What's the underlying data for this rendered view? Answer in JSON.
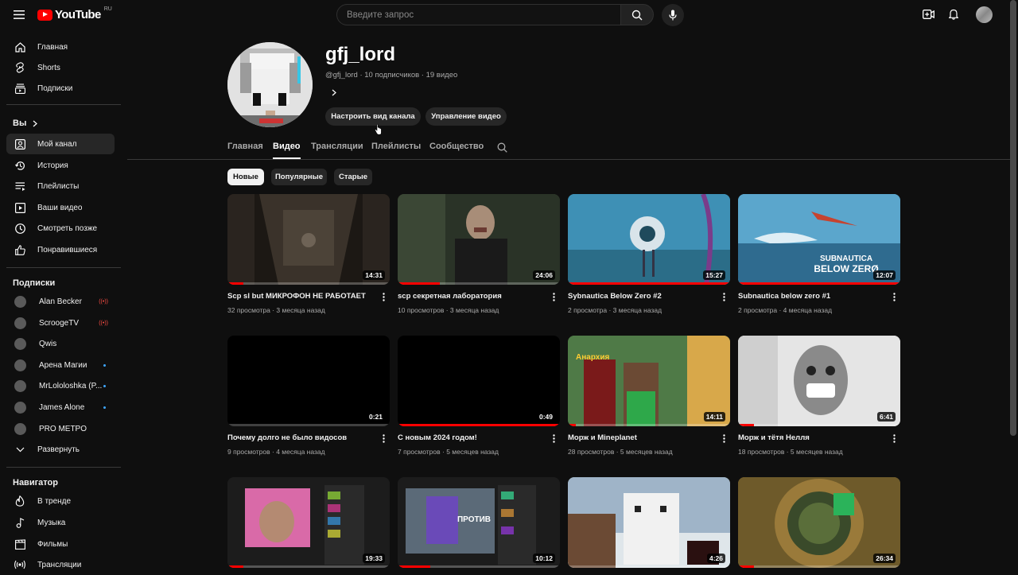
{
  "header": {
    "logo_text": "YouTube",
    "logo_region": "RU",
    "search_placeholder": "Введите запрос"
  },
  "sidebar": {
    "main": [
      {
        "label": "Главная",
        "icon": "home-icon"
      },
      {
        "label": "Shorts",
        "icon": "shorts-icon"
      },
      {
        "label": "Подписки",
        "icon": "subscriptions-icon"
      }
    ],
    "you_label": "Вы",
    "you_items": [
      {
        "label": "Мой канал",
        "icon": "channel-icon"
      },
      {
        "label": "История",
        "icon": "history-icon"
      },
      {
        "label": "Плейлисты",
        "icon": "playlists-icon"
      },
      {
        "label": "Ваши видео",
        "icon": "your-videos-icon"
      },
      {
        "label": "Смотреть позже",
        "icon": "watch-later-icon"
      },
      {
        "label": "Понравившиеся",
        "icon": "liked-icon"
      }
    ],
    "subs_label": "Подписки",
    "subs": [
      {
        "label": "Alan Becker",
        "status": "live"
      },
      {
        "label": "ScroogeTV",
        "status": "live"
      },
      {
        "label": "Qwis",
        "status": ""
      },
      {
        "label": "Арена Магии",
        "status": "new"
      },
      {
        "label": "MrLololoshka (P...",
        "status": "new"
      },
      {
        "label": "James Alone",
        "status": "new"
      },
      {
        "label": "PRO METPO",
        "status": ""
      }
    ],
    "expand_label": "Развернуть",
    "nav_label": "Навигатор",
    "nav": [
      {
        "label": "В тренде",
        "icon": "trending-icon"
      },
      {
        "label": "Музыка",
        "icon": "music-icon"
      },
      {
        "label": "Фильмы",
        "icon": "movies-icon"
      },
      {
        "label": "Трансляции",
        "icon": "live-icon"
      }
    ]
  },
  "channel": {
    "name": "gfj_lord",
    "meta": "@gfj_lord · 10 подписчиков · 19 видео",
    "customize_label": "Настроить вид канала",
    "manage_label": "Управление видео"
  },
  "tabs": [
    "Главная",
    "Видео",
    "Трансляции",
    "Плейлисты",
    "Сообщество"
  ],
  "active_tab": "Видео",
  "chips": [
    "Новые",
    "Популярные",
    "Старые"
  ],
  "videos": [
    {
      "title": "Scp sl but МИКРОФОН НЕ РАБОТАЕТ",
      "meta": "32 просмотра · 3 месяца назад",
      "duration": "14:31",
      "progress": 0.1,
      "thumb_color": "#2a231d"
    },
    {
      "title": "scp секретная лаборатория",
      "meta": "10 просмотров · 3 месяца назад",
      "duration": "24:06",
      "progress": 0.26,
      "thumb_color": "#2e3a2c"
    },
    {
      "title": "Sybnautica Below Zero #2",
      "meta": "2 просмотра · 3 месяца назад",
      "duration": "15:27",
      "progress": 1.0,
      "thumb_color": "#2f7ea0"
    },
    {
      "title": "Subnautica below zero #1",
      "meta": "2 просмотра · 4 месяца назад",
      "duration": "12:07",
      "progress": 1.0,
      "thumb_color": "#3b88b5"
    },
    {
      "title": "Почему долго не было видосов",
      "meta": "9 просмотров · 4 месяца назад",
      "duration": "0:21",
      "progress": 0.0,
      "thumb_color": "#000000"
    },
    {
      "title": "С новым 2024 годом!",
      "meta": "7 просмотров · 5 месяцев назад",
      "duration": "0:49",
      "progress": 1.0,
      "thumb_color": "#000000"
    },
    {
      "title": "Морж и Mineplanet",
      "meta": "28 просмотров · 5 месяцев назад",
      "duration": "14:11",
      "progress": 0.05,
      "thumb_color": "#3d6a3a"
    },
    {
      "title": "Морж и тётя Нелля",
      "meta": "18 просмотров · 5 месяцев назад",
      "duration": "6:41",
      "progress": 0.1,
      "thumb_color": "#d9d9d9"
    },
    {
      "title": "",
      "meta": "",
      "duration": "19:33",
      "progress": 0.1,
      "thumb_color": "#1c1c1c"
    },
    {
      "title": "",
      "meta": "",
      "duration": "10:12",
      "progress": 0.2,
      "thumb_color": "#1c1c1c"
    },
    {
      "title": "",
      "meta": "",
      "duration": "4:26",
      "progress": 0.0,
      "thumb_color": "#7b8a6f"
    },
    {
      "title": "",
      "meta": "",
      "duration": "26:34",
      "progress": 0.1,
      "thumb_color": "#8a6a2a"
    }
  ],
  "thumb_text": {
    "anarchy": "Анархия",
    "subnautica_1": "SUBNAUTICA",
    "subnautica_2": "BELOW ZERØ",
    "vs": "ПРОТИВ"
  }
}
